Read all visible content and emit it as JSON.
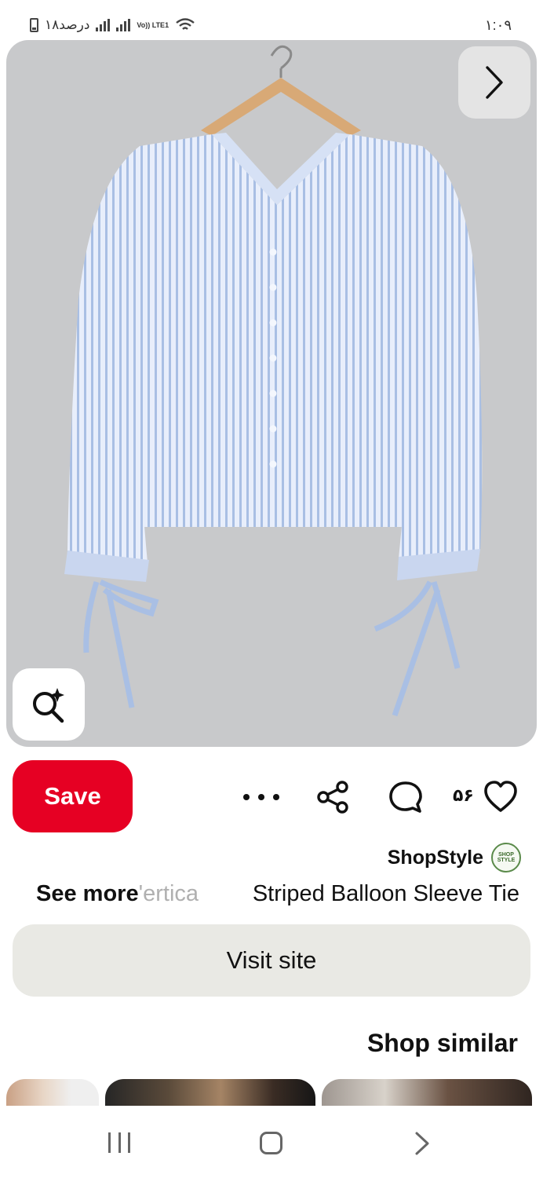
{
  "status_bar": {
    "battery_text": "۱۸درصد",
    "network_label": "Vo)) LTE1",
    "time": "۱:۰۹"
  },
  "image": {
    "subject": "light blue vertical striped v-neck balloon sleeve tie cuff blouse on wooden hanger",
    "background_color": "#c8c9cb"
  },
  "actions": {
    "save_label": "Save",
    "more_icon": "more-horizontal-icon",
    "share_icon": "share-icon",
    "comment_icon": "comment-icon",
    "like_count": "۵۶",
    "like_icon": "heart-icon"
  },
  "pin": {
    "source_name": "ShopStyle",
    "source_logo_text": "SHOP STYLE",
    "see_more": "See more",
    "desc_fade": "'ertica",
    "title": "Striped Balloon Sleeve Tie",
    "visit_label": "Visit site"
  },
  "shop_similar": {
    "heading": "Shop similar"
  },
  "colors": {
    "save_red": "#e60023",
    "visit_bg": "#e9e9e4"
  }
}
